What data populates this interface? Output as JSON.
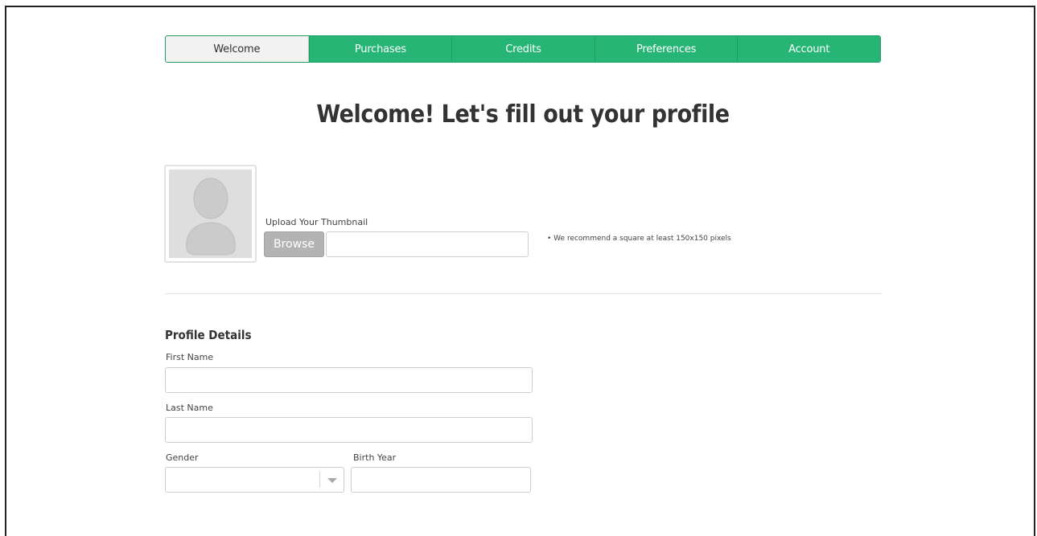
{
  "nav": {
    "tabs": [
      {
        "label": "Welcome",
        "active": true
      },
      {
        "label": "Purchases",
        "active": false
      },
      {
        "label": "Credits",
        "active": false
      },
      {
        "label": "Preferences",
        "active": false
      },
      {
        "label": "Account",
        "active": false
      }
    ]
  },
  "page": {
    "title": "Welcome! Let's fill out your profile"
  },
  "thumbnail": {
    "label": "Upload Your Thumbnail",
    "browse_label": "Browse",
    "file_value": "",
    "hint": "• We recommend a square at least 150x150 pixels"
  },
  "profile": {
    "section_title": "Profile Details",
    "first_name": {
      "label": "First Name",
      "value": ""
    },
    "last_name": {
      "label": "Last Name",
      "value": ""
    },
    "gender": {
      "label": "Gender",
      "value": ""
    },
    "birth_year": {
      "label": "Birth Year",
      "value": ""
    }
  },
  "colors": {
    "accent": "#26b574",
    "accent_border": "#1f9e63",
    "active_tab_bg": "#f2f2f2",
    "browse_button": "#b3b3b3"
  },
  "icons": {
    "avatar": "user-silhouette-icon",
    "select_arrow": "chevron-down-icon"
  }
}
